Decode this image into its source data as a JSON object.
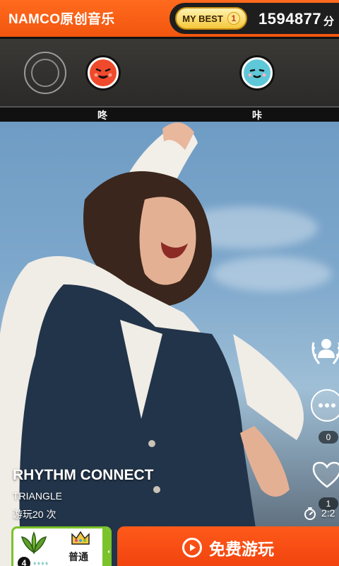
{
  "header": {
    "app_title": "NAMCO原创音乐",
    "mybest_label": "MY BEST",
    "mybest_rank": "1",
    "score": "1594877",
    "score_unit": "分"
  },
  "lane": {
    "don_label": "咚",
    "ka_label": "咔"
  },
  "sidebar": {
    "comment_count": "0",
    "like_count": "1",
    "info_label": "i"
  },
  "song": {
    "title": "RHYTHM CONNECT",
    "artist": "TRIANGLE",
    "play_count": "游玩20 次",
    "duration": "2:2"
  },
  "difficulty": {
    "level": "4",
    "name": "普通"
  },
  "play_button": {
    "label": "免费游玩"
  },
  "colors": {
    "brand_orange": "#f2560e",
    "don_red": "#f04a2c",
    "ka_blue": "#5ec8d8",
    "difficulty_green": "#7ac32b"
  }
}
